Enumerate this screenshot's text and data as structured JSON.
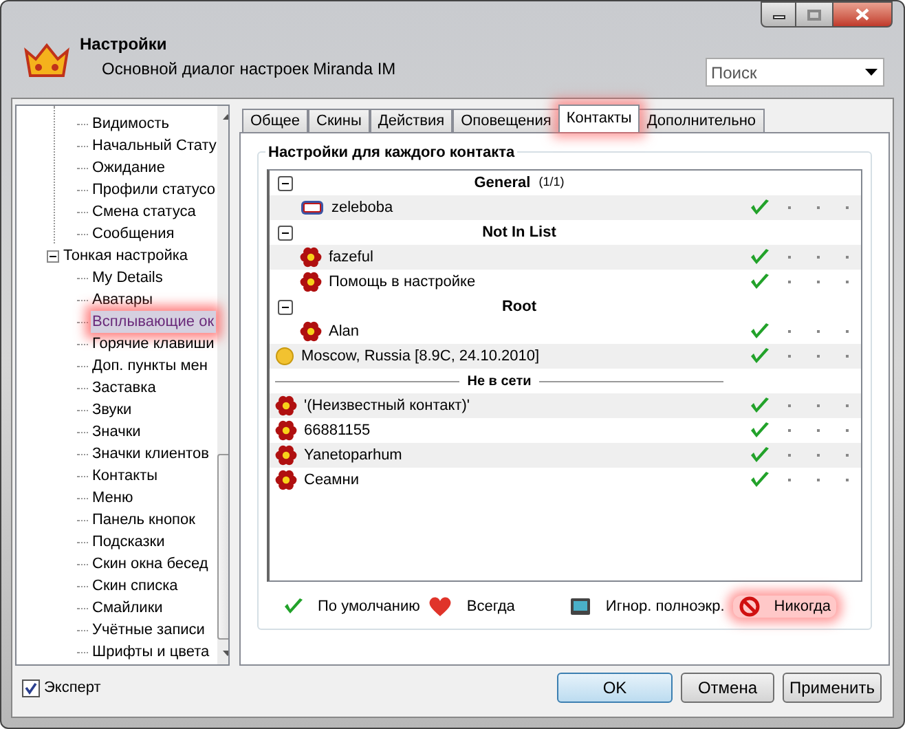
{
  "window": {
    "title": "Настройки",
    "subtitle": "Основной диалог настроек Miranda IM"
  },
  "search": {
    "placeholder": "Поиск"
  },
  "tree": {
    "partial_branch": [
      {
        "label": "Видимость",
        "selected": false
      },
      {
        "label": "Начальный Стату",
        "selected": false
      },
      {
        "label": "Ожидание",
        "selected": false
      },
      {
        "label": "Профили статусо",
        "selected": false
      },
      {
        "label": "Смена статуса",
        "selected": false
      },
      {
        "label": "Сообщения",
        "selected": false
      }
    ],
    "items": [
      {
        "label": "Тонкая настройка",
        "expanded": true,
        "children": [
          {
            "label": "My Details",
            "selected": false
          },
          {
            "label": "Аватары",
            "selected": false
          },
          {
            "label": "Всплывающие ок",
            "selected": true,
            "highlighted": true
          },
          {
            "label": "Горячие клавиши",
            "selected": false
          },
          {
            "label": "Доп. пункты мен",
            "selected": false
          },
          {
            "label": "Заставка",
            "selected": false
          },
          {
            "label": "Звуки",
            "selected": false
          },
          {
            "label": "Значки",
            "selected": false
          },
          {
            "label": "Значки клиентов",
            "selected": false
          },
          {
            "label": "Контакты",
            "selected": false
          },
          {
            "label": "Меню",
            "selected": false
          },
          {
            "label": "Панель кнопок",
            "selected": false
          },
          {
            "label": "Подсказки",
            "selected": false
          },
          {
            "label": "Скин окна бесед",
            "selected": false
          },
          {
            "label": "Скин списка",
            "selected": false
          },
          {
            "label": "Смайлики",
            "selected": false
          },
          {
            "label": "Учётные записи",
            "selected": false
          },
          {
            "label": "Шрифты и цвета",
            "selected": false
          }
        ]
      }
    ]
  },
  "tabs": [
    {
      "label": "Общее",
      "selected": false
    },
    {
      "label": "Скины",
      "selected": false
    },
    {
      "label": "Действия",
      "selected": false
    },
    {
      "label": "Оповещения",
      "selected": false
    },
    {
      "label": "Контакты",
      "selected": true,
      "highlighted": true
    },
    {
      "label": "Дополнительно",
      "selected": false
    }
  ],
  "group_title": "Настройки для каждого контакта",
  "contacts": [
    {
      "kind": "group",
      "label": "General",
      "count": "(1/1)",
      "expanded": true
    },
    {
      "kind": "badge_contact",
      "label": "zeleboba",
      "default": true
    },
    {
      "kind": "group",
      "label": "Not In List",
      "expanded": true
    },
    {
      "kind": "contact",
      "label": "fazeful",
      "default": true
    },
    {
      "kind": "contact",
      "label": "Помощь в настройке",
      "default": true
    },
    {
      "kind": "group",
      "label": "Root",
      "expanded": true
    },
    {
      "kind": "contact",
      "label": "Alan",
      "default": true
    },
    {
      "kind": "weather",
      "label": "Moscow, Russia  [8.9C, 24.10.2010]",
      "default": true
    },
    {
      "kind": "divider",
      "label": "Не в сети"
    },
    {
      "kind": "offline",
      "label": "'(Неизвестный контакт)'",
      "default": true
    },
    {
      "kind": "offline",
      "label": "66881155",
      "default": true
    },
    {
      "kind": "offline",
      "label": "Yanetoparhum",
      "default": true
    },
    {
      "kind": "offline",
      "label": "Сеамни",
      "default": true
    }
  ],
  "legend": [
    {
      "kind": "default",
      "label": "По умолчанию",
      "highlighted": false
    },
    {
      "kind": "always",
      "label": "Всегда",
      "highlighted": false
    },
    {
      "kind": "fullscreen",
      "label": "Игнор. полноэкр.",
      "highlighted": false
    },
    {
      "kind": "never",
      "label": "Никогда",
      "highlighted": true
    }
  ],
  "expert": {
    "label": "Эксперт",
    "checked": true
  },
  "buttons": [
    {
      "label": "OK",
      "default": true
    },
    {
      "label": "Отмена",
      "default": false
    },
    {
      "label": "Применить",
      "default": false
    }
  ]
}
